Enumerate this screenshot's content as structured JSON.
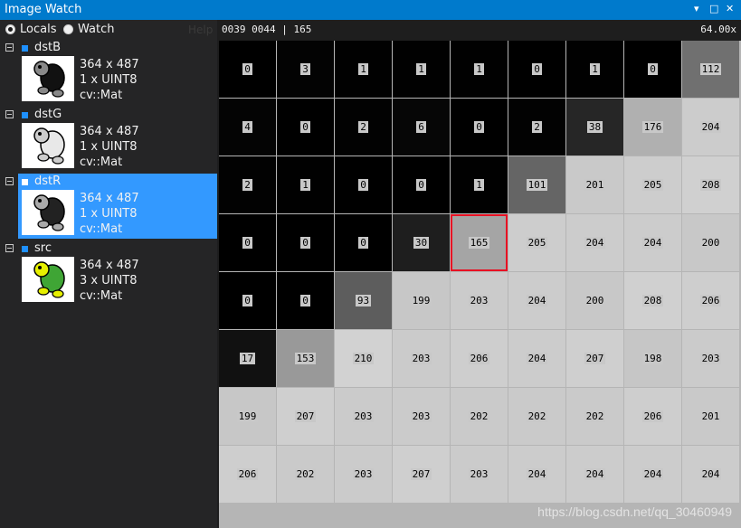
{
  "window": {
    "title": "Image Watch",
    "controls": [
      "▾",
      "□",
      "✕"
    ]
  },
  "left_panel": {
    "radio_locals": "Locals",
    "radio_watch": "Watch",
    "help": "Help",
    "selected_radio": "Locals",
    "items": [
      {
        "name": "dstB",
        "size": "364 x 487",
        "channels": "1 x UINT8",
        "type": "cv::Mat",
        "selected": false,
        "thumb": "dark"
      },
      {
        "name": "dstG",
        "size": "364 x 487",
        "channels": "1 x UINT8",
        "type": "cv::Mat",
        "selected": false,
        "thumb": "light"
      },
      {
        "name": "dstR",
        "size": "364 x 487",
        "channels": "1 x UINT8",
        "type": "cv::Mat",
        "selected": true,
        "thumb": "mid"
      },
      {
        "name": "src",
        "size": "364 x 487",
        "channels": "3 x UINT8",
        "type": "cv::Mat",
        "selected": false,
        "thumb": "color"
      }
    ]
  },
  "status": {
    "coords": "0039 0044",
    "sep": "|",
    "value": "165",
    "zoom": "64.00x"
  },
  "grid": {
    "cols": 9,
    "selected": [
      3,
      4
    ],
    "rows": [
      [
        0,
        3,
        1,
        1,
        1,
        0,
        1,
        0,
        112
      ],
      [
        4,
        0,
        2,
        6,
        0,
        2,
        38,
        176,
        204
      ],
      [
        2,
        1,
        0,
        0,
        1,
        101,
        201,
        205,
        208
      ],
      [
        0,
        0,
        0,
        30,
        165,
        205,
        204,
        204,
        200
      ],
      [
        0,
        0,
        93,
        199,
        203,
        204,
        200,
        208,
        206
      ],
      [
        17,
        153,
        210,
        203,
        206,
        204,
        207,
        198,
        203
      ],
      [
        199,
        207,
        203,
        203,
        202,
        202,
        202,
        206,
        201
      ],
      [
        206,
        202,
        203,
        207,
        203,
        204,
        204,
        204,
        204
      ]
    ]
  },
  "watermark": "https://blog.csdn.net/qq_30460949"
}
